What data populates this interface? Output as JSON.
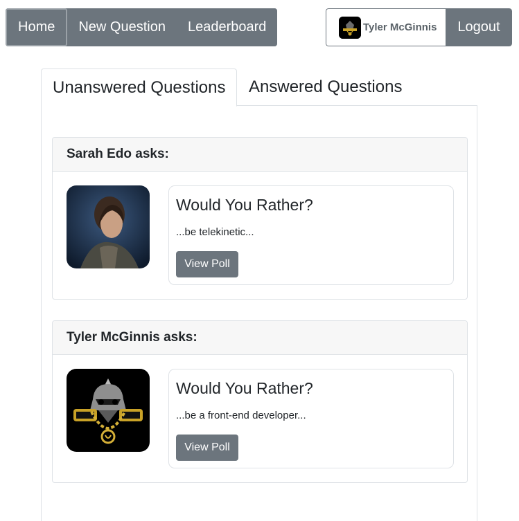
{
  "nav": {
    "home": "Home",
    "new_question": "New Question",
    "leaderboard": "Leaderboard"
  },
  "user": {
    "name": "Tyler McGinnis",
    "logout": "Logout"
  },
  "tabs": {
    "unanswered": "Unanswered Questions",
    "answered": "Answered Questions"
  },
  "questions": [
    {
      "asker": "Sarah Edo asks:",
      "title": "Would You Rather?",
      "preview": "...be telekinetic...",
      "button": "View Poll"
    },
    {
      "asker": "Tyler McGinnis asks:",
      "title": "Would You Rather?",
      "preview": "...be a front-end developer...",
      "button": "View Poll"
    }
  ],
  "colors": {
    "button_gray": "#6c757d",
    "header_bg": "#f7f7f7",
    "border": "#dee2e6"
  }
}
